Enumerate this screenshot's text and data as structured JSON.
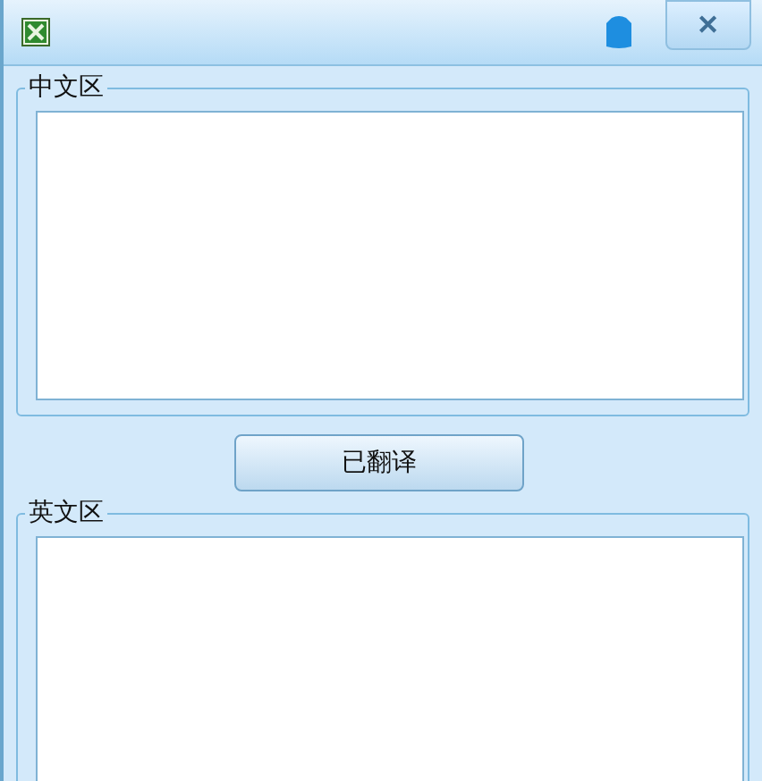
{
  "window": {
    "close": "✕"
  },
  "groups": [
    {
      "legend": "中文区"
    },
    {
      "legend": "英文区"
    }
  ],
  "button": "已翻译"
}
